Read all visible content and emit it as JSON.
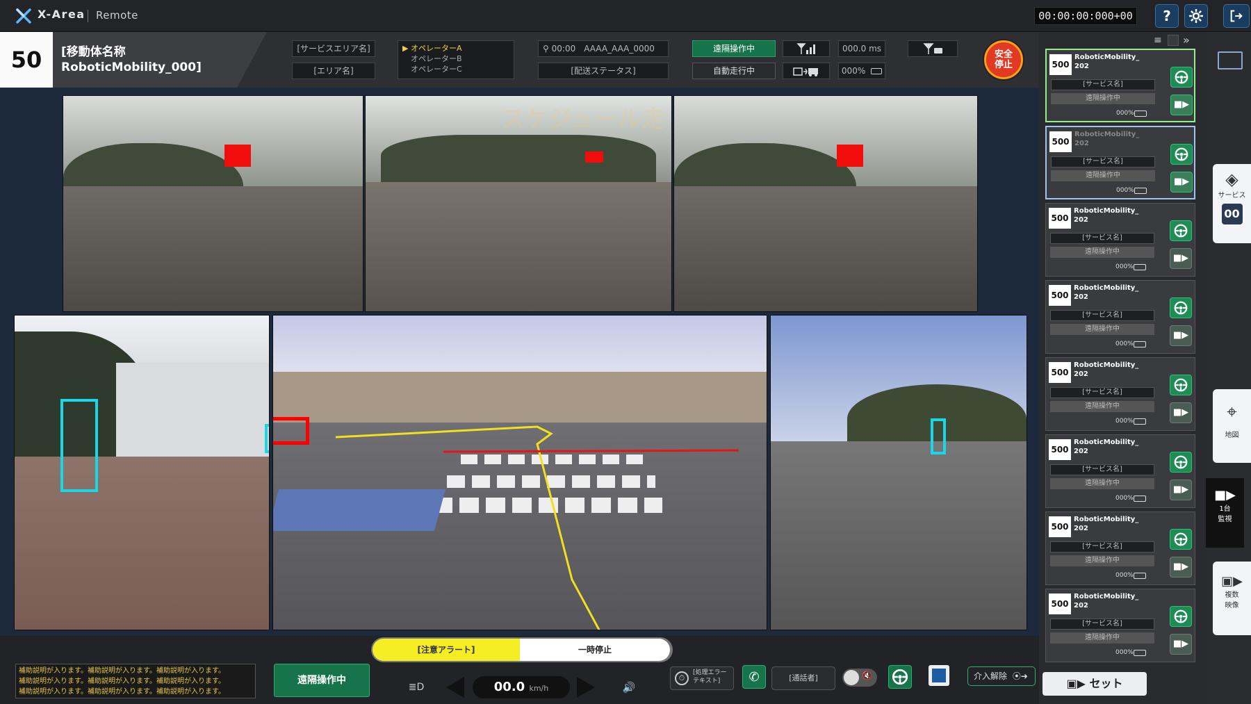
{
  "app": {
    "title": "X-Area",
    "subtitle": "Remote"
  },
  "timecode": "00:00:00:000+00",
  "top_buttons": {
    "help": "?",
    "settings": "gear-icon",
    "logout": "logout-icon"
  },
  "vehicle": {
    "number": "50",
    "label": "[移動体名称",
    "name": "RoboticMobility_000]",
    "service_area": "[サービスエリア名]",
    "area": "[エリア名]",
    "operators": [
      "▶ オペレーターA",
      "オペレーターB",
      "オペレーターC"
    ],
    "location": "00:00　AAAA_AAA_0000",
    "delivery_status": "[配送ステータス]",
    "remote_status": "遠隔操作中",
    "auto_status": "自動走行中",
    "latency": "000.0 ms",
    "battery": "000%",
    "emergency_stop": [
      "安全",
      "停止"
    ]
  },
  "camera": {
    "overlay_text": "スケジュール走"
  },
  "bottom": {
    "assist_text": [
      "補助説明が入ります。補助説明が入ります。補助説明が入ります。",
      "補助説明が入ります。補助説明が入ります。補助説明が入ります。",
      "補助説明が入ります。補助説明が入ります。補助説明が入ります。"
    ],
    "remote_op": "遠隔操作中",
    "alert": "[注意アラート]",
    "pause": "一時停止",
    "speed": "00.0",
    "speed_unit": "km/h",
    "error_text": [
      "[処理エラー",
      "テキスト]"
    ],
    "caller": "[通話者]",
    "intervene": "介入解除"
  },
  "right_panel": {
    "set_label": "セット",
    "cards": [
      {
        "num": "500",
        "name": [
          "RoboticMobility_",
          "202"
        ],
        "service": "[サービス名]",
        "status": "遠隔操作中",
        "battery": "000%",
        "state": "sel"
      },
      {
        "num": "500",
        "name": [
          "RoboticMobility_",
          "202"
        ],
        "service": "[サービス名]",
        "status": "遠隔操作中",
        "battery": "000%",
        "state": "sel2"
      },
      {
        "num": "500",
        "name": [
          "RoboticMobility_",
          "202"
        ],
        "service": "[サービス名]",
        "status": "遠隔操作中",
        "battery": "000%",
        "state": ""
      },
      {
        "num": "500",
        "name": [
          "RoboticMobility_",
          "202"
        ],
        "service": "[サービス名]",
        "status": "遠隔操作中",
        "battery": "000%",
        "state": ""
      },
      {
        "num": "500",
        "name": [
          "RoboticMobility_",
          "202"
        ],
        "service": "[サービス名]",
        "status": "遠隔操作中",
        "battery": "000%",
        "state": ""
      },
      {
        "num": "500",
        "name": [
          "RoboticMobility_",
          "202"
        ],
        "service": "[サービス名]",
        "status": "遠隔操作中",
        "battery": "000%",
        "state": ""
      },
      {
        "num": "500",
        "name": [
          "RoboticMobility_",
          "202"
        ],
        "service": "[サービス名]",
        "status": "遠隔操作中",
        "battery": "000%",
        "state": ""
      },
      {
        "num": "500",
        "name": [
          "RoboticMobility_",
          "202"
        ],
        "service": "[サービス名]",
        "status": "遠隔操作中",
        "battery": "000%",
        "state": ""
      }
    ]
  },
  "far_nav": {
    "service": "サービス",
    "service_count": "00",
    "map": "地図",
    "single_monitor": [
      "1台",
      "監視"
    ],
    "multi_video": [
      "複数",
      "映像"
    ]
  }
}
